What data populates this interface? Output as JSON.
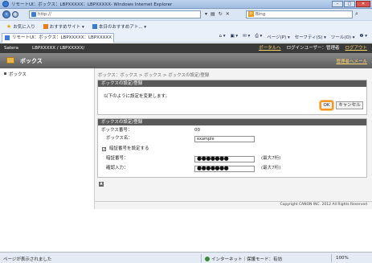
{
  "window": {
    "title": "リモートUI：ボックス：LBPXXXXX：LBPXXXXX- Windows Internet Explorer"
  },
  "address_bar": {
    "url": "http://",
    "search_placeholder": "Bing"
  },
  "favorites_bar": {
    "favorites_label": "お気に入り",
    "suggested_sites": "おすすめサイト ▾",
    "recommended_today": "本日のおすすめアト... ▾"
  },
  "tab": {
    "label": "リモートUI：ボックス：LBPXXXXX：LBPXXXXX"
  },
  "command_bar": {
    "page": "ページ(P) ▾",
    "safety": "セーフティ(S) ▾",
    "tools": "ツール(O) ▾",
    "help": "❷ ▾"
  },
  "app_header": {
    "brand": "Satera",
    "device": "LBPXXXXX / LBPXXXXX/",
    "portal_link": "ポータルへ",
    "login_user": "ログインユーザー：管理者",
    "logout_link": "ログアウト"
  },
  "page_bar": {
    "title": "ボックス",
    "manager_link": "管理者へメール"
  },
  "sidebar": {
    "items": [
      {
        "label": "ボックス"
      }
    ]
  },
  "breadcrumb": "ボックス：ボックス > ボックス > ボックスの設定/登録",
  "confirm_panel": {
    "heading": "ボックスの設定/登録",
    "message": "以下のように設定を変更します。",
    "ok_label": "OK",
    "cancel_label": "キャンセル"
  },
  "settings_panel": {
    "heading": "ボックスの設定/登録",
    "box_number_label": "ボックス番号：",
    "box_number_value": "00",
    "box_name_label": "ボックス名：",
    "box_name_value": "example",
    "pin_checkbox_label": "暗証番号を設定する",
    "pin_checked": true,
    "pin_label": "暗証番号：",
    "pin_value": "●●●●●●●",
    "pin_hint": "(最大7桁)",
    "confirm_label": "確認入力：",
    "confirm_value": "●●●●●●●",
    "confirm_hint": "(最大7桁)"
  },
  "footer": {
    "copyright": "Copyright CANON INC. 2012 All Rights Reserved"
  },
  "status_bar": {
    "status_text": "ページが表示されました",
    "zone": "インターネット｜保護モード：有効",
    "zoom": "100%"
  }
}
